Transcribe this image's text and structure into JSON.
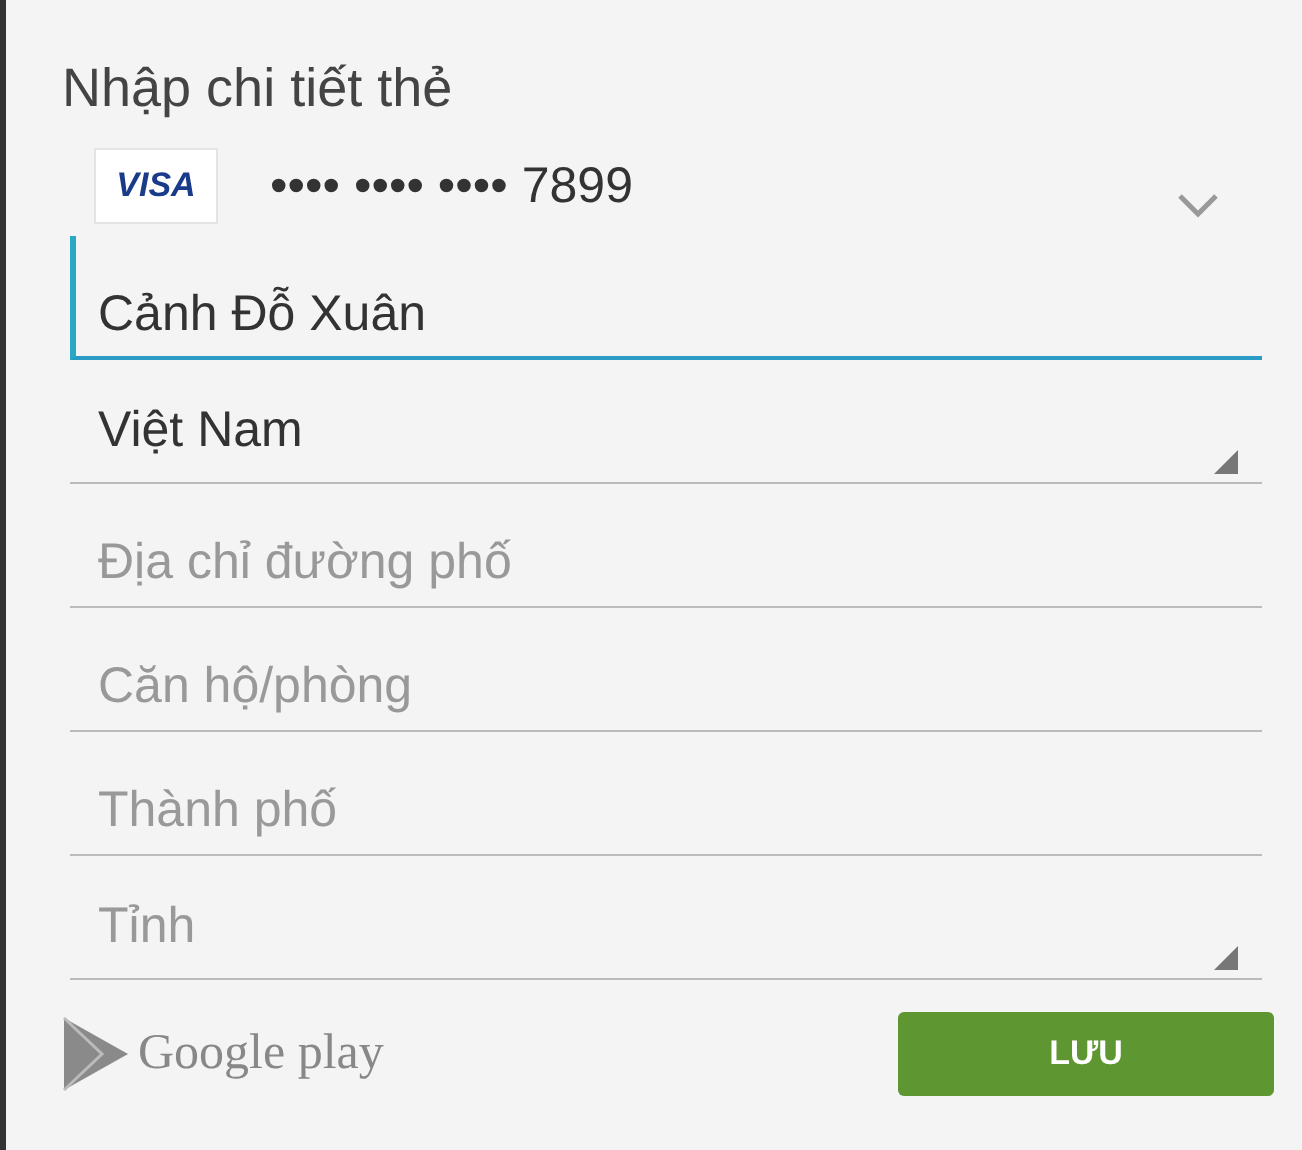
{
  "title": "Nhập chi tiết thẻ",
  "card": {
    "brand": "VISA",
    "number": "•••• •••• •••• 7899"
  },
  "fields": [
    {
      "kind": "text",
      "value": "Cảnh Đỗ Xuân",
      "focused": true
    },
    {
      "kind": "dropdown",
      "value": "Việt Nam",
      "focused": false
    },
    {
      "kind": "text",
      "placeholder": "Địa chỉ đường phố",
      "focused": false
    },
    {
      "kind": "text",
      "placeholder": "Căn hộ/phòng",
      "focused": false
    },
    {
      "kind": "text",
      "placeholder": "Thành phố",
      "focused": false
    },
    {
      "kind": "dropdown",
      "placeholder": "Tỉnh",
      "focused": false
    }
  ],
  "footer": {
    "brand": "Google play",
    "button": "LƯU"
  }
}
